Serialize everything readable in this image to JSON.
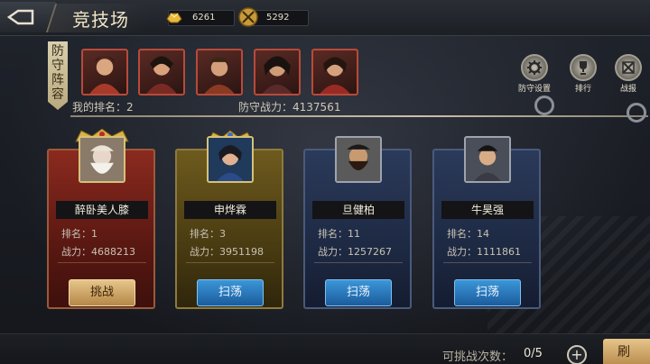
{
  "header": {
    "title": "竞技场",
    "gold": "6261",
    "tokens": "5292"
  },
  "lineup": {
    "tag": [
      "防",
      "守",
      "阵",
      "容"
    ],
    "my_rank_label": "我的排名：",
    "my_rank": "2",
    "power_label": "防守战力：",
    "power": "4137561"
  },
  "top_buttons": {
    "defense": "防守设置",
    "ranking": "排行",
    "report": "战报"
  },
  "opponents": [
    {
      "name": "醉卧美人膝",
      "rank_label": "排名：",
      "rank": "1",
      "power_label": "战力：",
      "power": "4688213",
      "action": "挑战"
    },
    {
      "name": "申烨霖",
      "rank_label": "排名：",
      "rank": "3",
      "power_label": "战力：",
      "power": "3951198",
      "action": "扫荡"
    },
    {
      "name": "旦健柏",
      "rank_label": "排名：",
      "rank": "11",
      "power_label": "战力：",
      "power": "1257267",
      "action": "扫荡"
    },
    {
      "name": "牛昊强",
      "rank_label": "排名：",
      "rank": "14",
      "power_label": "战力：",
      "power": "1111861",
      "action": "扫荡"
    }
  ],
  "footer": {
    "attempts_label": "可挑战次数：",
    "attempts": "0/5",
    "refresh": "刷"
  }
}
